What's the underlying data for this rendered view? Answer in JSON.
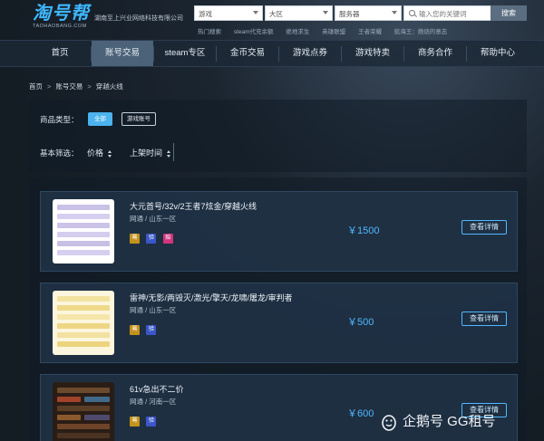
{
  "header": {
    "logo_text": "淘号帮",
    "logo_sub": "TAOHAOBANG.COM",
    "company": "湖南至上兴业网络科技有限公司",
    "selects": [
      "游戏",
      "大区",
      "服务器"
    ],
    "search_placeholder": "输入您的关键词",
    "search_button": "搜索",
    "hot_links": [
      "热门搜索",
      "steam代充余额",
      "绝地求生",
      "英雄联盟",
      "王者荣耀",
      "航海王：燃烧的意志"
    ]
  },
  "nav": {
    "items": [
      "首页",
      "账号交易",
      "steam专区",
      "金币交易",
      "游戏点券",
      "游戏特卖",
      "商务合作",
      "帮助中心"
    ],
    "active_index": 1
  },
  "breadcrumb": [
    "首页",
    "账号交易",
    "穿越火线"
  ],
  "filters": {
    "type_label": "商品类型：",
    "type_all": "全部",
    "type_account": "游戏账号",
    "basic_label": "基本筛选：",
    "sort_price": "价格",
    "sort_time": "上架时间"
  },
  "listings": [
    {
      "title": "大元首号/32v/2王者7炫金/穿越火线",
      "region": "网通 / 山东一区",
      "badges": [
        "蓦",
        "验",
        "赔"
      ],
      "price": "￥1500",
      "detail": "查看详情"
    },
    {
      "title": "雷神/无影/两毁灭/激光/擎天/龙啸/屠龙/审判者",
      "region": "网通 / 山东一区",
      "badges": [
        "蓦",
        "验"
      ],
      "price": "￥500",
      "detail": "查看详情"
    },
    {
      "title": "61v急出不二价",
      "region": "网通 / 河南一区",
      "badges": [
        "蓦",
        "验"
      ],
      "price": "￥600",
      "detail": "查看详情"
    }
  ],
  "colors": {
    "accent": "#4fb8ff",
    "nav_active": "#4b6278",
    "badge_yellow": "#c4921b",
    "badge_blue": "#3a56c8",
    "badge_pink": "#d1357d"
  },
  "watermark": "企鹅号 GG租号"
}
